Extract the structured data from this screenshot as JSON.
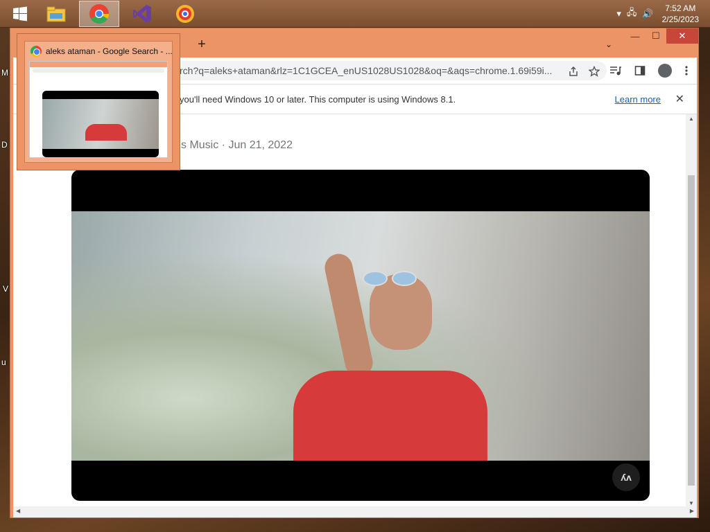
{
  "taskbar": {
    "start_icon": "windows-logo-icon",
    "apps": [
      {
        "name": "file-explorer-icon"
      },
      {
        "name": "chrome-icon",
        "active": true
      },
      {
        "name": "visual-studio-icon"
      },
      {
        "name": "yandex-browser-icon"
      }
    ],
    "tray": {
      "overflow_icon": "▾",
      "network_icon": "🖧",
      "volume_icon": "🔊",
      "time": "7:52 AM",
      "date": "2/25/2023"
    }
  },
  "desktop_labels": [
    "M",
    "D",
    "V",
    "u"
  ],
  "browser": {
    "new_tab": "+",
    "tab_search": "⌄",
    "window_controls": {
      "minimize": "—",
      "maximize": "☐",
      "close": "✕"
    },
    "omnibox_url": "rch?q=aleks+ataman&rlz=1C1GCEA_enUS1028US1028&oq=&aqs=chrome.1.69i59i...",
    "toolbar_icons": [
      "share-icon",
      "bookmark-star-icon",
      "media-control-icon",
      "side-panel-icon",
      "profile-icon",
      "menu-icon"
    ],
    "infobar": {
      "text": "you'll need Windows 10 or later. This computer is using Windows 8.1.",
      "link": "Learn more",
      "close": "✕"
    },
    "content": {
      "source_line": "s Music · Jun 21, 2022",
      "video_watermark": "ʎʌ"
    }
  },
  "tab_preview": {
    "title": "aleks ataman - Google Search - ..."
  }
}
